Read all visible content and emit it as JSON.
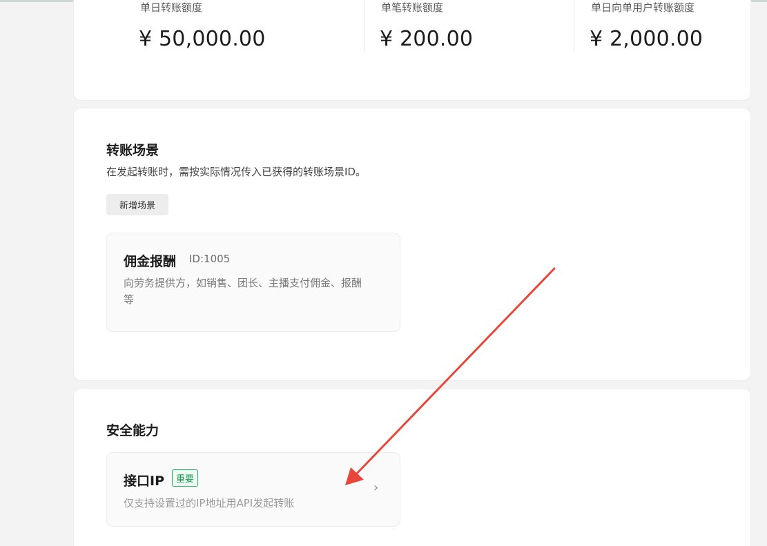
{
  "limits": [
    {
      "label": "单日转账额度",
      "value": "¥ 50,000.00"
    },
    {
      "label": "单笔转账额度",
      "value": "¥ 200.00"
    },
    {
      "label": "单日向单用户转账额度",
      "value": "¥ 2,000.00"
    }
  ],
  "scenes": {
    "title": "转账场景",
    "description": "在发起转账时，需按实际情况传入已获得的转账场景ID。",
    "add_button": "新增场景",
    "items": [
      {
        "name": "佣金报酬",
        "id": "ID:1005",
        "desc_line1": "向劳务提供方，如销售、团长、主播支付佣金、报酬",
        "desc_line2": "等"
      }
    ]
  },
  "security": {
    "title": "安全能力",
    "items": [
      {
        "name": "接口IP",
        "badge": "重要",
        "desc": "仅支持设置过的IP地址用API发起转账"
      }
    ]
  },
  "colors": {
    "accent_green": "#1fb463",
    "annotation_red": "#e8463a"
  },
  "icons": {
    "chevron": "chevron-right-icon"
  }
}
